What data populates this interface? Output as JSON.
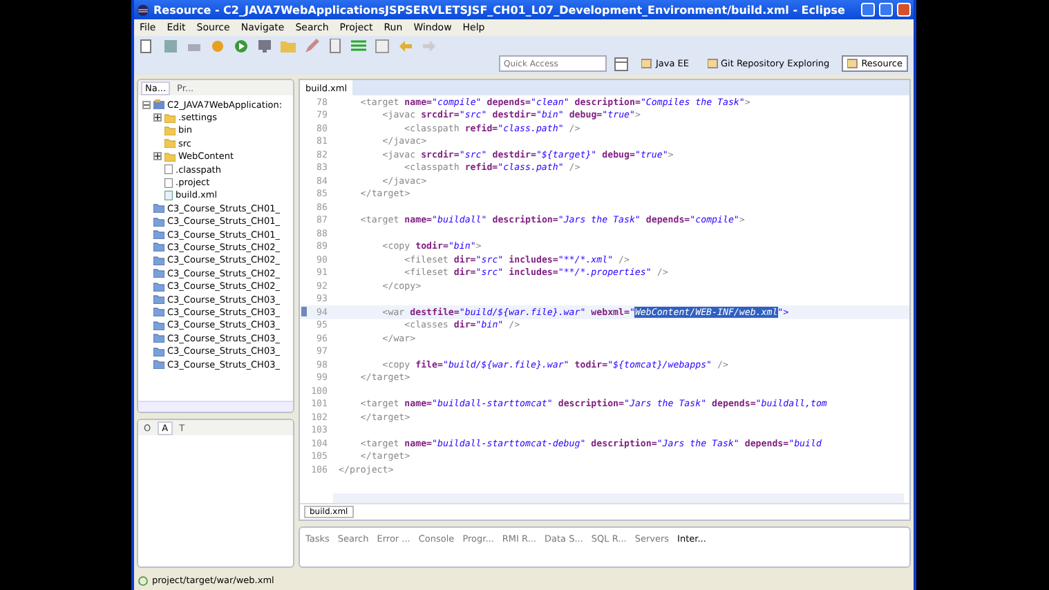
{
  "window": {
    "title": "Resource - C2_JAVA7WebApplicationsJSPSERVLETSJSF_CH01_L07_Development_Environment/build.xml - Eclipse"
  },
  "menu": [
    "File",
    "Edit",
    "Source",
    "Navigate",
    "Search",
    "Project",
    "Run",
    "Window",
    "Help"
  ],
  "quick_access": {
    "placeholder": "Quick Access"
  },
  "perspectives": [
    {
      "label": "Java EE",
      "selected": false
    },
    {
      "label": "Git Repository Exploring",
      "selected": false
    },
    {
      "label": "Resource",
      "selected": true
    }
  ],
  "navigator": {
    "tabs": [
      {
        "label": "Na...",
        "selected": true
      },
      {
        "label": "Pr...",
        "selected": false
      }
    ],
    "tree": [
      {
        "label": "C2_JAVA7WebApplication:",
        "kind": "project",
        "expanded": true,
        "children": [
          {
            "label": ".settings",
            "kind": "folder",
            "expanded": false
          },
          {
            "label": "bin",
            "kind": "folder"
          },
          {
            "label": "src",
            "kind": "folder"
          },
          {
            "label": "WebContent",
            "kind": "folder",
            "expanded": false
          },
          {
            "label": ".classpath",
            "kind": "file"
          },
          {
            "label": ".project",
            "kind": "file"
          },
          {
            "label": "build.xml",
            "kind": "xml"
          }
        ]
      },
      {
        "label": "C3_Course_Struts_CH01_",
        "kind": "closed-project"
      },
      {
        "label": "C3_Course_Struts_CH01_",
        "kind": "closed-project"
      },
      {
        "label": "C3_Course_Struts_CH01_",
        "kind": "closed-project"
      },
      {
        "label": "C3_Course_Struts_CH02_",
        "kind": "closed-project"
      },
      {
        "label": "C3_Course_Struts_CH02_",
        "kind": "closed-project"
      },
      {
        "label": "C3_Course_Struts_CH02_",
        "kind": "closed-project"
      },
      {
        "label": "C3_Course_Struts_CH02_",
        "kind": "closed-project"
      },
      {
        "label": "C3_Course_Struts_CH03_",
        "kind": "closed-project"
      },
      {
        "label": "C3_Course_Struts_CH03_",
        "kind": "closed-project"
      },
      {
        "label": "C3_Course_Struts_CH03_",
        "kind": "closed-project"
      },
      {
        "label": "C3_Course_Struts_CH03_",
        "kind": "closed-project"
      },
      {
        "label": "C3_Course_Struts_CH03_",
        "kind": "closed-project"
      },
      {
        "label": "C3_Course_Struts_CH03_",
        "kind": "closed-project"
      }
    ]
  },
  "outline": {
    "tabs": [
      {
        "label": "O",
        "selected": false
      },
      {
        "label": "A",
        "selected": true
      },
      {
        "label": "T",
        "selected": false
      }
    ]
  },
  "editor": {
    "tab": "build.xml",
    "bottom_tab": "build.xml",
    "lines": [
      {
        "number": "78",
        "current": false,
        "text": "    <target name=\"compile\" depends=\"clean\" description=\"Compiles the Task\">"
      },
      {
        "number": "79",
        "current": false,
        "text": "        <javac srcdir=\"src\" destdir=\"bin\" debug=\"true\">"
      },
      {
        "number": "80",
        "current": false,
        "text": "            <classpath refid=\"class.path\" />"
      },
      {
        "number": "81",
        "current": false,
        "text": "        </javac>"
      },
      {
        "number": "82",
        "current": false,
        "text": "        <javac srcdir=\"src\" destdir=\"${target}\" debug=\"true\">"
      },
      {
        "number": "83",
        "current": false,
        "text": "            <classpath refid=\"class.path\" />"
      },
      {
        "number": "84",
        "current": false,
        "text": "        </javac>"
      },
      {
        "number": "85",
        "current": false,
        "text": "    </target>"
      },
      {
        "number": "86",
        "current": false
      },
      {
        "number": "87",
        "current": false,
        "text": "    <target name=\"buildall\" description=\"Jars the Task\" depends=\"compile\">"
      },
      {
        "number": "88",
        "current": false
      },
      {
        "number": "89",
        "current": false,
        "text": "        <copy todir=\"bin\">"
      },
      {
        "number": "90",
        "current": false,
        "text": "            <fileset dir=\"src\" includes=\"**/*.xml\" />"
      },
      {
        "number": "91",
        "current": false,
        "text": "            <fileset dir=\"src\" includes=\"**/*.properties\" />"
      },
      {
        "number": "92",
        "current": false,
        "text": "        </copy>"
      },
      {
        "number": "93",
        "current": false
      },
      {
        "number": "94",
        "current": true,
        "text": "        <war destfile=\"build/${war.file}.war\" webxml=\"",
        "selected_text": "WebContent/WEB-INF/web.xml",
        "text_after": "\">"
      },
      {
        "number": "95",
        "current": false,
        "text": "            <classes dir=\"bin\" />"
      },
      {
        "number": "96",
        "current": false,
        "text": "        </war>"
      },
      {
        "number": "97",
        "current": false
      },
      {
        "number": "98",
        "current": false,
        "text": "        <copy file=\"build/${war.file}.war\" todir=\"${tomcat}/webapps\" />"
      },
      {
        "number": "99",
        "current": false,
        "text": "    </target>"
      },
      {
        "number": "100",
        "current": false
      },
      {
        "number": "101",
        "current": false,
        "text": "    <target name=\"buildall-starttomcat\" description=\"Jars the Task\" depends=\"buildall,tom"
      },
      {
        "number": "102",
        "current": false,
        "text": "    </target>"
      },
      {
        "number": "103",
        "current": false
      },
      {
        "number": "104",
        "current": false,
        "text": "    <target name=\"buildall-starttomcat-debug\" description=\"Jars the Task\" depends=\"build"
      },
      {
        "number": "105",
        "current": false,
        "text": "    </target>"
      },
      {
        "number": "106",
        "current": false,
        "text": "</project>"
      }
    ]
  },
  "bottom_tabs": [
    {
      "label": "Tasks",
      "selected": false
    },
    {
      "label": "Search",
      "selected": false
    },
    {
      "label": "Error ...",
      "selected": false
    },
    {
      "label": "Console",
      "selected": false
    },
    {
      "label": "Progr...",
      "selected": false
    },
    {
      "label": "RMI R...",
      "selected": false
    },
    {
      "label": "Data S...",
      "selected": false
    },
    {
      "label": "SQL R...",
      "selected": false
    },
    {
      "label": "Servers",
      "selected": false
    },
    {
      "label": "Inter...",
      "selected": true
    }
  ],
  "status_bar": {
    "text": "project/target/war/web.xml"
  }
}
